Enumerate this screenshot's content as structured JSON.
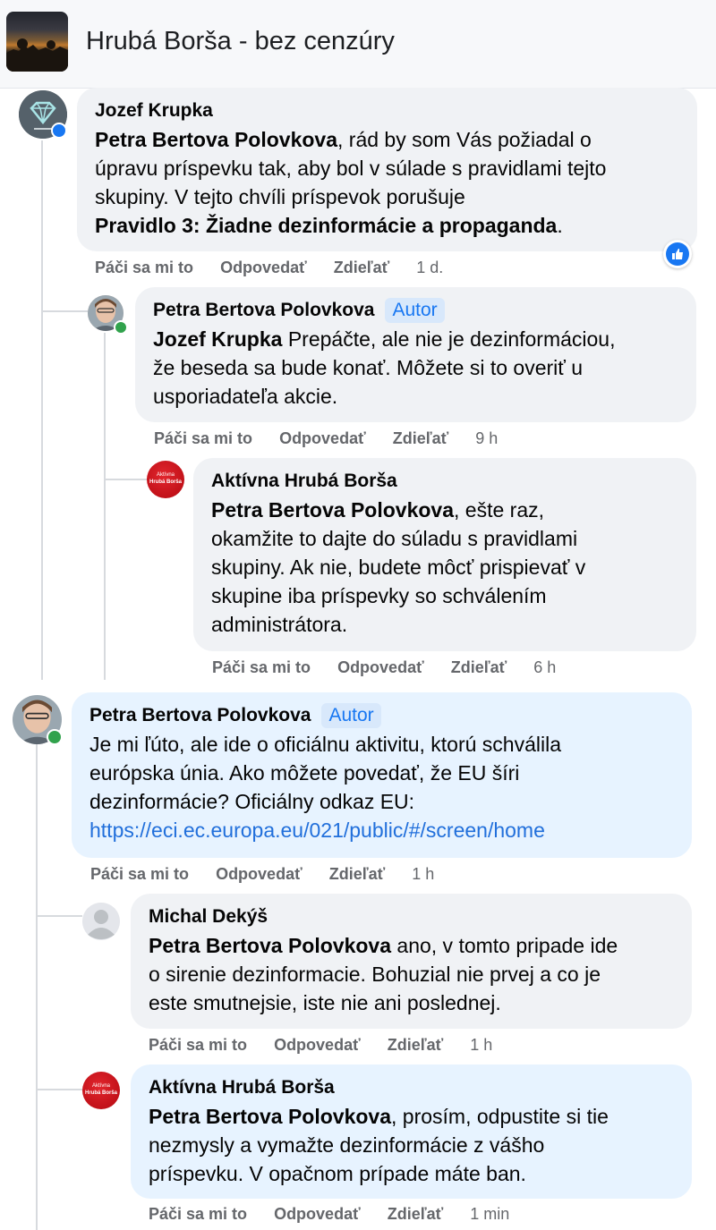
{
  "header": {
    "group_name": "Hrubá Borša - bez cenzúry"
  },
  "actions": {
    "like": "Páči sa mi to",
    "reply": "Odpovedať",
    "share": "Zdieľať"
  },
  "comments": [
    {
      "author": "Jozef Krupka",
      "mention": "Petra Bertova Polovkova",
      "line1_rest": ", rád by som Vás požiadal o",
      "line2": "úpravu príspevku tak, aby bol v súlade s pravidlami tejto",
      "line3": "skupiny. V tejto chvíli príspevok porušuje",
      "line4_bold": "Pravidlo 3: Žiadne dezinformácie a propaganda",
      "line4_rest": ".",
      "time": "1 d.",
      "reaction": "like-icon"
    },
    {
      "author": "Petra Bertova Polovkova",
      "badge": "Autor",
      "mention": "Jozef Krupka",
      "line1_rest": " Prepáčte, ale nie je dezinformáciou,",
      "line2": "že beseda sa bude konať. Môžete si to overiť u",
      "line3": "usporiadateľa akcie.",
      "time": "9 h"
    },
    {
      "author": "Aktívna Hrubá Borša",
      "logo_line1": "Aktívna",
      "logo_line2": "Hrubá Borša",
      "mention": "Petra Bertova Polovkova",
      "line1_rest": ", ešte raz,",
      "line2": "okamžite to dajte do súladu s pravidlami",
      "line3": "skupiny. Ak nie, budete môcť prispievať v",
      "line4": "skupine iba príspevky so schválením",
      "line5": "administrátora.",
      "time": "6 h"
    },
    {
      "author": "Petra Bertova Polovkova",
      "badge": "Autor",
      "line1": "Je mi ľúto, ale ide o oficiálnu aktivitu, ktorú schválila",
      "line2": "európska únia. Ako môžete povedať, že EU šíri",
      "line3": "dezinformácie? Oficiálny odkaz EU:",
      "link": "https://eci.ec.europa.eu/021/public/#/screen/home",
      "time": "1 h"
    },
    {
      "author": "Michal Dekýš",
      "mention": "Petra Bertova Polovkova",
      "line1_rest": " ano, v tomto pripade ide",
      "line2": "o sirenie dezinformacie. Bohuzial nie prvej a co je",
      "line3": "este smutnejsie, iste nie ani poslednej.",
      "time": "1 h"
    },
    {
      "author": "Aktívna Hrubá Borša",
      "logo_line1": "Aktívna",
      "logo_line2": "Hrubá Borša",
      "mention": "Petra Bertova Polovkova",
      "line1_rest": ", prosím, odpustite si tie",
      "line2": "nezmysly a vymažte dezinformácie z vášho",
      "line3": "príspevku. V opačnom prípade máte ban.",
      "time": "1 min"
    }
  ]
}
